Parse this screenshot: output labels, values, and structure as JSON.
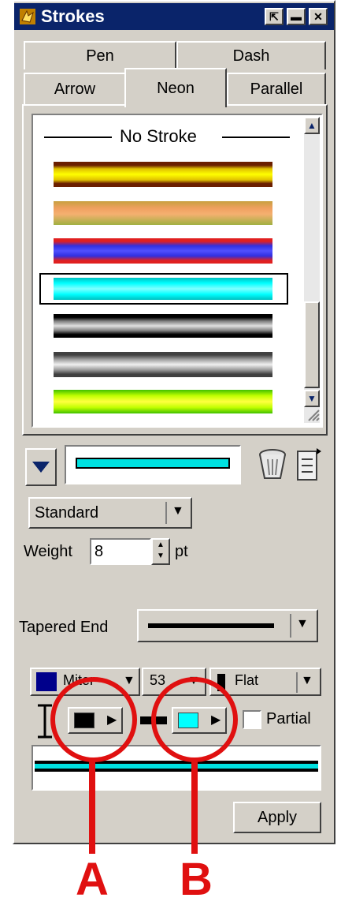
{
  "window": {
    "title": "Strokes",
    "title_icon": "strokes-app-icon",
    "controls": [
      "pin-icon",
      "minimize-icon",
      "close-icon"
    ]
  },
  "tabs": {
    "row1": [
      {
        "label": "Pen"
      },
      {
        "label": "Dash"
      }
    ],
    "row2": [
      {
        "label": "Arrow"
      },
      {
        "label": "Neon",
        "selected": true
      },
      {
        "label": "Parallel"
      }
    ]
  },
  "stroke_list": {
    "no_stroke_label": "No Stroke",
    "items": [
      {
        "name": "neon-brown-yellow",
        "colors": [
          "#6b1f00",
          "#e0c000",
          "#ffff00",
          "#e0c000",
          "#6b1f00"
        ]
      },
      {
        "name": "neon-orange-green",
        "colors": [
          "#c8a040",
          "#f0a060",
          "#f4b070",
          "#a0b040"
        ]
      },
      {
        "name": "neon-red-blue",
        "colors": [
          "#e02020",
          "#3030e0",
          "#5050ff",
          "#3030e0",
          "#e02020"
        ]
      },
      {
        "name": "neon-cyan",
        "colors": [
          "#00c0c0",
          "#00ffff",
          "#80ffff",
          "#00ffff",
          "#00c0c0"
        ],
        "selected": true
      },
      {
        "name": "neon-black-gray",
        "colors": [
          "#000000",
          "#808080",
          "#e0e0e0",
          "#808080",
          "#000000"
        ]
      },
      {
        "name": "neon-gray-silver",
        "colors": [
          "#404040",
          "#a0a0a0",
          "#f0f0f0",
          "#a0a0a0",
          "#404040"
        ]
      },
      {
        "name": "neon-green-yellow",
        "colors": [
          "#40c000",
          "#c0ff00",
          "#ffff40",
          "#c0ff00",
          "#40c000"
        ]
      }
    ]
  },
  "preview_row": {
    "dropdown_icon": "triangle-down-icon",
    "trash_icon": "trash-icon",
    "new_icon": "new-stroke-icon",
    "preview_color": "#00e0e0"
  },
  "standard_select": {
    "value": "Standard"
  },
  "weight": {
    "label": "Weight",
    "value": "8",
    "unit": "pt"
  },
  "tapered_end": {
    "label": "Tapered End"
  },
  "join_select": {
    "value": "Miter"
  },
  "miter_select": {
    "value": "53"
  },
  "cap_select": {
    "value": "Flat"
  },
  "color_pickers": {
    "outer": {
      "color": "#000000"
    },
    "inner": {
      "color": "#00ffff"
    }
  },
  "partial_checkbox": {
    "label": "Partial",
    "checked": false
  },
  "apply_button": {
    "label": "Apply"
  },
  "callouts": {
    "a": "A",
    "b": "B"
  },
  "colors": {
    "panel": "#d4d0c8",
    "title": "#0a246a",
    "callout": "#e01010"
  }
}
